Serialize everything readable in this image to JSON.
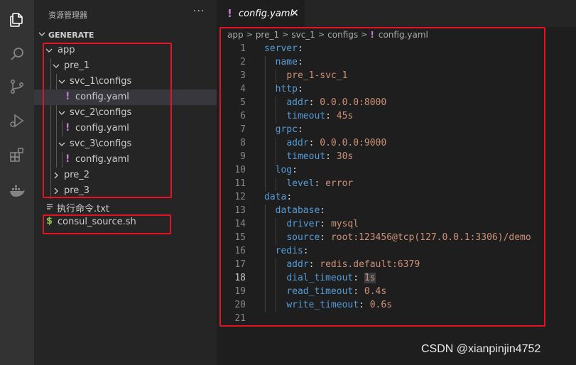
{
  "activity_bar": {
    "icons": [
      "explorer-icon",
      "search-icon",
      "source-control-icon",
      "run-debug-icon",
      "extensions-icon",
      "docker-icon"
    ]
  },
  "sidebar": {
    "title": "资源管理器",
    "more": "···",
    "section": "GENERATE",
    "tree": [
      {
        "label": "app",
        "type": "folder",
        "expanded": true
      },
      {
        "label": "pre_1",
        "type": "folder",
        "expanded": true
      },
      {
        "label": "svc_1\\configs",
        "type": "folder",
        "expanded": true
      },
      {
        "label": "config.yaml",
        "type": "yaml",
        "selected": true
      },
      {
        "label": "svc_2\\configs",
        "type": "folder",
        "expanded": true
      },
      {
        "label": "config.yaml",
        "type": "yaml"
      },
      {
        "label": "svc_3\\configs",
        "type": "folder",
        "expanded": true
      },
      {
        "label": "config.yaml",
        "type": "yaml"
      },
      {
        "label": "pre_2",
        "type": "folder",
        "expanded": false
      },
      {
        "label": "pre_3",
        "type": "folder",
        "expanded": false
      },
      {
        "label": "执行命令.txt",
        "type": "text"
      },
      {
        "label": "consul_source.sh",
        "type": "shell"
      }
    ]
  },
  "editor": {
    "tab": {
      "label": "config.yaml",
      "close": "✕"
    },
    "breadcrumb": [
      "app",
      "pre_1",
      "svc_1",
      "configs",
      "config.yaml"
    ],
    "active_line": 18,
    "lines": [
      {
        "num": "1",
        "key": "server",
        "val": ""
      },
      {
        "num": "2",
        "key": "name",
        "val": ""
      },
      {
        "num": "3",
        "key": "",
        "val": "pre_1-svc_1"
      },
      {
        "num": "4",
        "key": "http",
        "val": ""
      },
      {
        "num": "5",
        "key": "addr",
        "val": "0.0.0.0:8000"
      },
      {
        "num": "6",
        "key": "timeout",
        "val": "45s"
      },
      {
        "num": "7",
        "key": "grpc",
        "val": ""
      },
      {
        "num": "8",
        "key": "addr",
        "val": "0.0.0.0:9000"
      },
      {
        "num": "9",
        "key": "timeout",
        "val": "30s"
      },
      {
        "num": "10",
        "key": "log",
        "val": ""
      },
      {
        "num": "11",
        "key": "level",
        "val": "error"
      },
      {
        "num": "12",
        "key": "data",
        "val": ""
      },
      {
        "num": "13",
        "key": "database",
        "val": ""
      },
      {
        "num": "14",
        "key": "driver",
        "val": "mysql"
      },
      {
        "num": "15",
        "key": "source",
        "val": "root:123456@tcp(127.0.0.1:3306)/demo"
      },
      {
        "num": "16",
        "key": "redis",
        "val": ""
      },
      {
        "num": "17",
        "key": "addr",
        "val": "redis.default:6379"
      },
      {
        "num": "18",
        "key": "dial_timeout",
        "val": "1s"
      },
      {
        "num": "19",
        "key": "read_timeout",
        "val": "0.4s"
      },
      {
        "num": "20",
        "key": "write_timeout",
        "val": "0.6s"
      },
      {
        "num": "21",
        "key": "",
        "val": ""
      }
    ]
  },
  "colors": {
    "highlight_box": "#e81123",
    "yaml_icon": "#c678dd",
    "shell_icon": "#8dc149",
    "key": "#569cd6",
    "string": "#ce9178"
  },
  "watermark": "CSDN @xianpinjin4752"
}
